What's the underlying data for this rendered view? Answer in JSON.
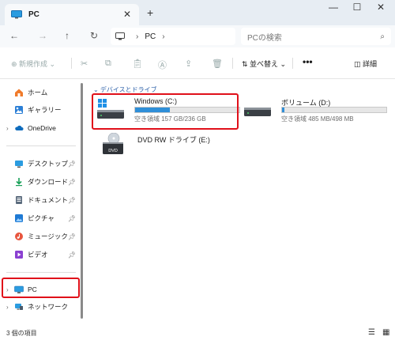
{
  "window": {
    "tab_title": "PC",
    "tab_close": "✕",
    "new_tab": "+",
    "minimize": "—",
    "maximize": "☐",
    "close": "✕"
  },
  "nav": {
    "back": "←",
    "forward": "→",
    "up": "↑",
    "refresh": "↻",
    "breadcrumb": "PC",
    "search_placeholder": "PCの検索"
  },
  "toolbar": {
    "new_label": "⊕ 新規作成 ⌄",
    "sort_label": "⇅ 並べ替え ⌄",
    "more_label": "•••",
    "details_label": "◫ 詳細"
  },
  "sidebar": {
    "items": [
      {
        "label": "ホーム",
        "icon": "home-icon"
      },
      {
        "label": "ギャラリー",
        "icon": "gallery-icon"
      },
      {
        "label": "OneDrive",
        "icon": "cloud-icon"
      },
      {
        "label": "デスクトップ",
        "icon": "desktop-icon"
      },
      {
        "label": "ダウンロード",
        "icon": "download-icon"
      },
      {
        "label": "ドキュメント",
        "icon": "document-icon"
      },
      {
        "label": "ピクチャ",
        "icon": "pictures-icon"
      },
      {
        "label": "ミュージック",
        "icon": "music-icon"
      },
      {
        "label": "ビデオ",
        "icon": "video-icon"
      },
      {
        "label": "PC",
        "icon": "pc-icon"
      },
      {
        "label": "ネットワーク",
        "icon": "network-icon"
      }
    ]
  },
  "main": {
    "group_label": "⌄ デバイスとドライブ",
    "drives": [
      {
        "name": "Windows (C:)",
        "free": "空き領域 157 GB/236 GB",
        "used_fraction": 0.335
      },
      {
        "name": "ボリューム (D:)",
        "free": "空き領域 485 MB/498 MB",
        "used_fraction": 0.026
      },
      {
        "name": "DVD RW ドライブ (E:)"
      }
    ]
  },
  "status": {
    "item_count": "3 個の項目"
  },
  "colors": {
    "accent": "#2f8fd8",
    "highlight": "#e0101a",
    "group": "#2b5fa8"
  }
}
